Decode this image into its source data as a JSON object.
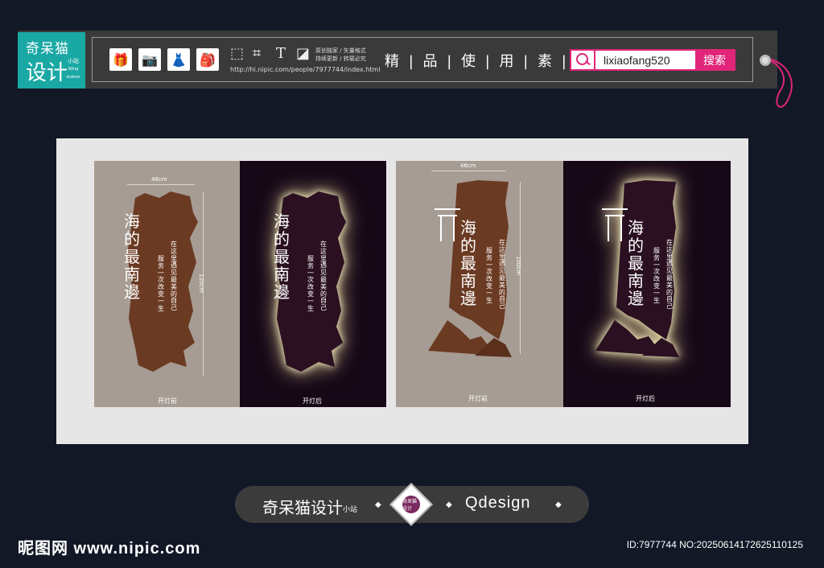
{
  "brand": {
    "name": "奇呆猫",
    "name2": "设计",
    "sub": "小站",
    "sub_en": "Wing station"
  },
  "toolbar": {
    "icons": [
      "gift-icon",
      "camera-icon",
      "dress-icon",
      "backpack-icon"
    ],
    "tools": [
      "select-icon",
      "crop-icon",
      "text-icon",
      "layer-icon"
    ],
    "note_line1": "原创独家 / 矢量格式",
    "note_line2": "持续更新 / 转载必究",
    "url": "http://hi.nipic.com/people/7977744/index.html",
    "tagline": "精 | 品 | 使 | 用 | 素 | 材"
  },
  "search": {
    "value": "lixiaofang520",
    "button": "搜索"
  },
  "artwork": {
    "sign_title": [
      "海",
      "的",
      "最",
      "南",
      "邊"
    ],
    "sign_text_a": [
      "在",
      "这",
      "里",
      " ",
      "遇",
      "见",
      "最",
      "美",
      "的",
      "自",
      "己"
    ],
    "sign_text_b": [
      "服",
      "务",
      "一",
      "次",
      " ",
      "改",
      "变",
      "一",
      "生"
    ],
    "width_label_1": "46cm",
    "height_label_1": "120cm",
    "width_label_2": "46cm",
    "height_label_2": "100cm",
    "caption_off": "开灯前",
    "caption_on": "开灯后"
  },
  "bottom": {
    "brand": "奇呆猫设计",
    "brand_sub": "小站",
    "badge": "奇呆猫设计",
    "design": "Qdesign"
  },
  "footer": {
    "site": "昵图网 www.nipic.com",
    "id": "ID:7977744 NO:20250614172625110125"
  },
  "colors": {
    "accent": "#e0257a",
    "teal": "#1aa8a4",
    "wood": "#6b3a22",
    "dark_panel": "#170817",
    "beige_panel": "#a69c93"
  }
}
